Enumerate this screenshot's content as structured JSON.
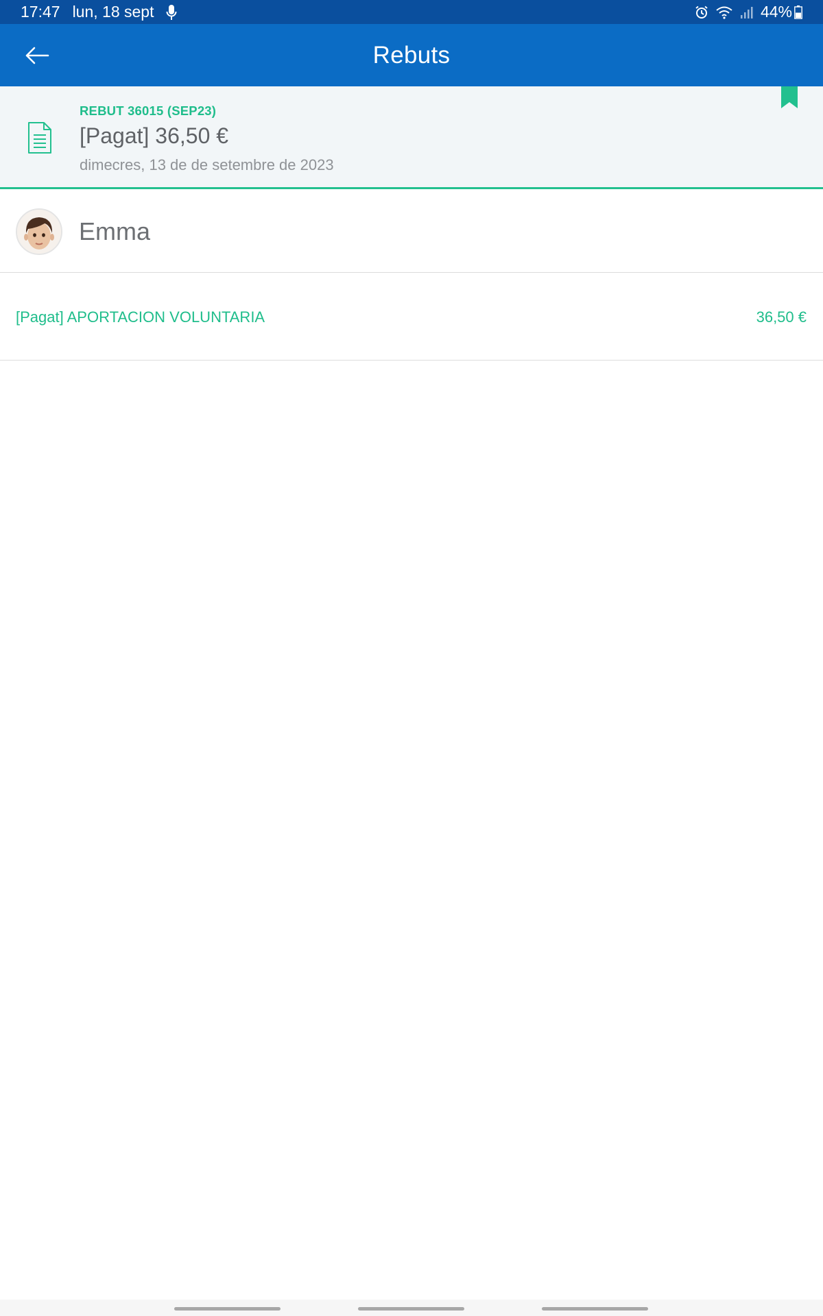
{
  "status_bar": {
    "time": "17:47",
    "date": "lun, 18 sept",
    "battery": "44%",
    "icons": [
      "mic-icon",
      "alarm-icon",
      "wifi-icon",
      "signal-icon",
      "battery-icon"
    ]
  },
  "app_bar": {
    "title": "Rebuts",
    "back_icon": "arrow-left-icon"
  },
  "receipt": {
    "code": "REBUT 36015 (SEP23)",
    "amount": "[Pagat] 36,50 €",
    "date": "dimecres, 13 de de setembre de 2023",
    "icon": "document-icon",
    "bookmark_icon": "bookmark-icon"
  },
  "student": {
    "name": "Emma",
    "avatar": "avatar-photo"
  },
  "items": [
    {
      "label": "[Pagat] APORTACION VOLUNTARIA",
      "amount": "36,50 €"
    }
  ],
  "colors": {
    "status_bar": "#0a4f9e",
    "app_bar": "#0b6cc5",
    "accent_green": "#1fbd8b",
    "header_bg": "#f2f6f8"
  }
}
